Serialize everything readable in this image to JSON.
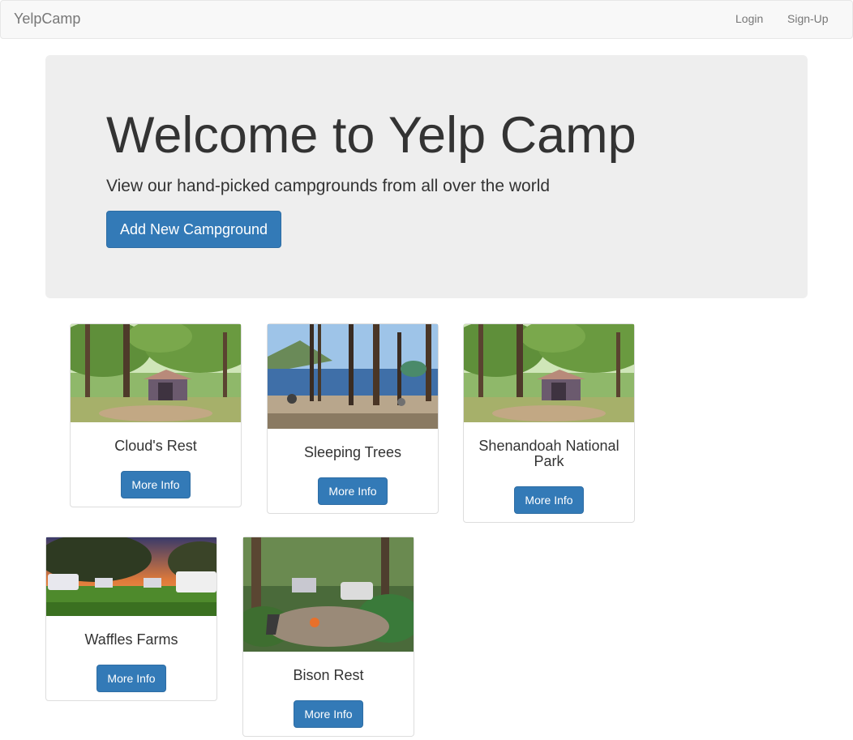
{
  "navbar": {
    "brand": "YelpCamp",
    "links": [
      {
        "label": "Login"
      },
      {
        "label": "Sign-Up"
      }
    ]
  },
  "jumbotron": {
    "title": "Welcome to Yelp Camp",
    "subtitle": "View our hand-picked campgrounds from all over the world",
    "button_label": "Add New Campground"
  },
  "campgrounds": [
    {
      "name": "Cloud's Rest",
      "button": "More Info",
      "image": "tent-gazebo-forest"
    },
    {
      "name": "Sleeping Trees",
      "button": "More Info",
      "image": "lakeside-pine-camp"
    },
    {
      "name": "Shenandoah National Park",
      "button": "More Info",
      "image": "tent-gazebo-forest"
    },
    {
      "name": "Waffles Farms",
      "button": "More Info",
      "image": "rv-park-sunset"
    },
    {
      "name": "Bison Rest",
      "button": "More Info",
      "image": "forest-campfire-site"
    }
  ]
}
